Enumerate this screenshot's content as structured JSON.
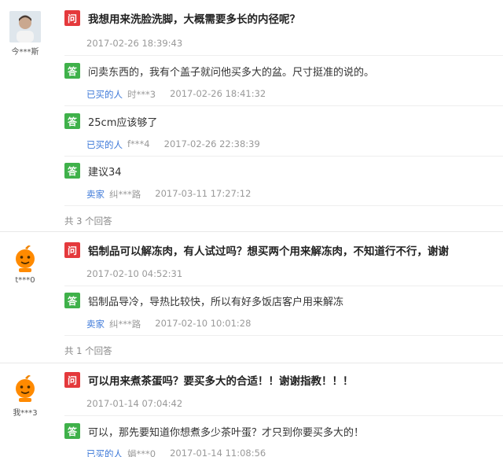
{
  "questions": [
    {
      "user": "今***斯",
      "question": "我想用来洗脸洗脚，大概需要多长的内径呢？",
      "date": "2017-02-26 18:39:43",
      "answers": [
        {
          "text": "问卖东西的，我有个盖子就问他买多大的盆。尺寸挺准的说的。",
          "role": "已买的人",
          "nick": "时***3",
          "date": "2017-02-26 18:41:32"
        },
        {
          "text": "25cm应该够了",
          "role": "已买的人",
          "nick": "f***4",
          "date": "2017-02-26 22:38:39"
        },
        {
          "text": "建议34",
          "role": "卖家",
          "nick": "纠***路",
          "date": "2017-03-11 17:27:12"
        }
      ],
      "total": "共 3 个回答"
    },
    {
      "user": "t***0",
      "question": "铝制品可以解冻肉，有人试过吗？想买两个用来解冻肉，不知道行不行，谢谢",
      "date": "2017-02-10 04:52:31",
      "answers": [
        {
          "text": "铝制品导冷，导热比较快，所以有好多饭店客户用来解冻",
          "role": "卖家",
          "nick": "纠***路",
          "date": "2017-02-10 10:01:28"
        }
      ],
      "total": "共 1 个回答"
    },
    {
      "user": "我***3",
      "question": "可以用来煮茶蛋吗？要买多大的合适！！谢谢指教！！！",
      "date": "2017-01-14 07:04:42",
      "answers": [
        {
          "text": "可以，那先要知道你想煮多少茶叶蛋？才只到你要买多大的！",
          "role": "已买的人",
          "nick": "娟***0",
          "date": "2017-01-14 11:08:56"
        }
      ]
    }
  ],
  "labels": {
    "question_tag": "问",
    "answer_tag": "答"
  },
  "colors": {
    "question_tag": "#e4393c",
    "answer_tag": "#3fb14a",
    "role_link": "#3c78d8",
    "muted": "#999999"
  },
  "icons": {
    "avatar_1": "user-photo",
    "avatar_2": "taobao-mascot-avatar",
    "avatar_3": "taobao-mascot-avatar"
  }
}
